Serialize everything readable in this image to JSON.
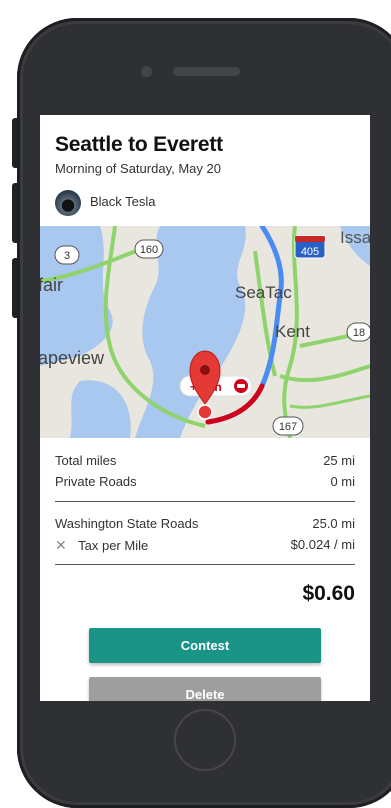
{
  "trip": {
    "title": "Seattle to Everett",
    "subtitle": "Morning of Saturday, May 20",
    "vehicle": "Black Tesla"
  },
  "map": {
    "labels": {
      "route_3": "3",
      "route_160": "160",
      "route_405": "405",
      "route_18": "18",
      "route_167": "167",
      "issaquah_partial": "Issa",
      "fair_partial": "fair",
      "seatac": "SeaTac",
      "kent": "Kent",
      "apeview_partial": "apeview",
      "traffic_delay": "+ min"
    },
    "colors": {
      "water": "#a8c8ef",
      "land": "#e9e6df",
      "route": "#4a8cf2",
      "traffic_red": "#d0021b",
      "highway": "#8ed36b",
      "pin": "#e53935"
    }
  },
  "summary": {
    "total_miles_label": "Total miles",
    "total_miles_value": "25 mi",
    "private_roads_label": "Private Roads",
    "private_roads_value": "0 mi",
    "state_roads_label": "Washington State Roads",
    "state_roads_value": "25.0 mi",
    "multiply_symbol": "✕",
    "tax_label": "Tax per Mile",
    "tax_value": "$0.024 / mi",
    "total_amount": "$0.60"
  },
  "actions": {
    "contest_label": "Contest",
    "delete_label": "Delete"
  },
  "colors": {
    "primary": "#199487",
    "secondary": "#9e9e9e",
    "phone_body": "#2f3033"
  }
}
